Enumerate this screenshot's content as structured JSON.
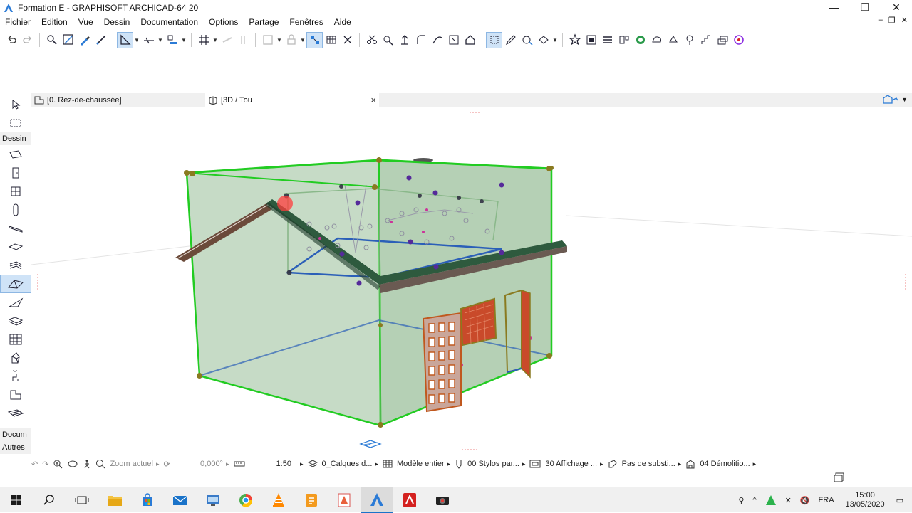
{
  "window": {
    "title": "Formation E - GRAPHISOFT ARCHICAD-64 20",
    "minimize": "—",
    "restore": "❐",
    "close": "✕"
  },
  "menu": {
    "items": [
      "Fichier",
      "Edition",
      "Vue",
      "Dessin",
      "Documentation",
      "Options",
      "Partage",
      "Fenêtres",
      "Aide"
    ],
    "mdi_minimize": "–",
    "mdi_restore": "❐",
    "mdi_close": "✕"
  },
  "toolbox": {
    "section_dessin": "Dessin",
    "section_documentation": "Docum",
    "section_autres": "Autres"
  },
  "tabs": {
    "floor_plan": "[0. Rez-de-chaussée]",
    "view_3d": "[3D / Tou",
    "close": "×"
  },
  "statusbar": {
    "zoom_label": "Zoom actuel",
    "angle": "0,000°",
    "scale": "1:50",
    "layers": "0_Calques d...",
    "model": "Modèle entier",
    "pens": "00 Stylos par...",
    "display": "30 Affichage ...",
    "substitution": "Pas de substi...",
    "renovation": "04 Démolitio..."
  },
  "taskbar": {
    "language": "FRA",
    "time": "15:00",
    "date": "13/05/2020"
  },
  "colors": {
    "accent": "#1a73c9",
    "wall_fill": "#a8c8a8",
    "wall_edge": "#22cc22",
    "roof": "#2e5a3e",
    "door": "#c0581e",
    "selection_blue": "#2b5fb8"
  }
}
